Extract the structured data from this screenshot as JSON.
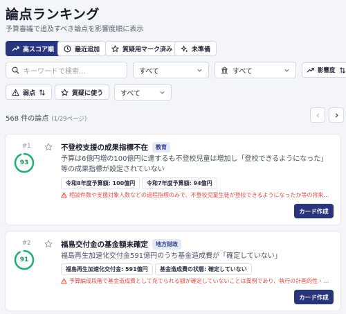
{
  "header": {
    "title": "論点ランキング",
    "subtitle": "予算審議で追及すべき論点を影響度順に表示"
  },
  "sort_tabs": [
    {
      "label": "高スコア順",
      "icon": "trend-up-icon",
      "active": true
    },
    {
      "label": "最近追加",
      "icon": "clock-icon",
      "active": false
    },
    {
      "label": "質疑用マーク済み",
      "icon": "star-icon",
      "active": false
    },
    {
      "label": "未準備",
      "icon": "sparkle-icon",
      "active": false
    }
  ],
  "filters": {
    "search_placeholder": "キーワードで検索...",
    "category_select": "すべて",
    "ministry_select": "すべて",
    "impact_sort_label": "影響度",
    "weakness_sort_label": "弱点",
    "use_in_question_label": "質疑に使う",
    "use_select": "すべて"
  },
  "results": {
    "count_text": "568 件の論点",
    "page_text": "(1/29ページ)"
  },
  "cards": [
    {
      "rank": "#1",
      "score": "93",
      "score_value": 93,
      "title": "不登校支援の成果指標不在",
      "tag": "教育",
      "description": "予算は6億円増の100億円に達するも不登校児童は増加し「登校できるようになった」等の成果指標が設定されていない",
      "pills": [
        "令和8年度予算額: 100億円",
        "令和7年度予算額: 94億円"
      ],
      "warning": "相談件数や支援対象人数などの過程指標のみで、不登校児童生徒が登校できるようになったか等の将来の…",
      "button": "カード作成"
    },
    {
      "rank": "#2",
      "score": "91",
      "score_value": 91,
      "title": "福島交付金の基金額未確定",
      "tag": "地方財政",
      "description": "福島再生加速化交付金591億円のうち基金造成費が「確定していない」",
      "pills": [
        "福島再生加速化交付金: 591億円",
        "基金造成費の状態: 確定していない"
      ],
      "warning": "予算編成段階で基金造成費として充てられる額が確定していないことは異例であり、執行の計画的性・透…",
      "button": "カード作成"
    }
  ],
  "colors": {
    "accent": "#27357e",
    "score_ring": "#1fae74",
    "warning": "#dc4f46",
    "tag_bg": "#e5eaf8"
  }
}
